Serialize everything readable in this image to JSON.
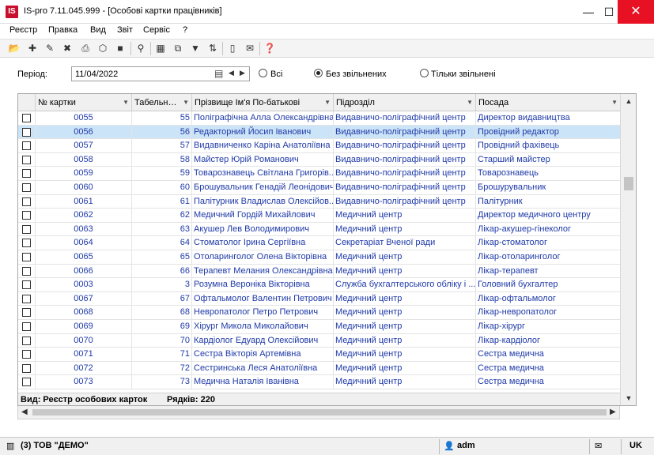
{
  "window": {
    "logo_text": "IS",
    "title": "IS-pro 7.11.045.999 - [Особові картки працівників]",
    "min_glyph": "—",
    "max_glyph": "☐",
    "close_glyph": "✕"
  },
  "menu": [
    "Реєстр",
    "Правка",
    "Вид",
    "Звіт",
    "Сервіс",
    "?"
  ],
  "filter": {
    "period_label": "Період:",
    "period_value": "11/04/2022",
    "radio_all": "Всі",
    "radio_without_dismissed": "Без звільнених",
    "radio_only_dismissed": "Тільки звільнені",
    "selected": "radio_without_dismissed"
  },
  "grid": {
    "columns": {
      "card": "№ картки",
      "tab": "Табельн…",
      "name": "Прізвище Ім'я По-батькові",
      "dept": "Підрозділ",
      "pos": "Посада"
    },
    "selected_row": 1,
    "rows": [
      {
        "card": "0055",
        "tab": "55",
        "name": "Поліграфічна Алла Олександрівна",
        "dept": "Видавничо-поліграфічний центр",
        "pos": "Директор видавництва"
      },
      {
        "card": "0056",
        "tab": "56",
        "name": "Редакторний Йосип Іванович",
        "dept": "Видавничо-поліграфічний центр",
        "pos": "Провідний редактор"
      },
      {
        "card": "0057",
        "tab": "57",
        "name": "Видавниченко Каріна Анатоліївна",
        "dept": "Видавничо-поліграфічний центр",
        "pos": "Провідний фахівець"
      },
      {
        "card": "0058",
        "tab": "58",
        "name": "Майстер Юрій Романович",
        "dept": "Видавничо-поліграфічний центр",
        "pos": "Старший майстер"
      },
      {
        "card": "0059",
        "tab": "59",
        "name": "Товарознавець Світлана Григорів...",
        "dept": "Видавничо-поліграфічний центр",
        "pos": "Товарознавець"
      },
      {
        "card": "0060",
        "tab": "60",
        "name": "Брошувальник Генадій Леонідович",
        "dept": "Видавничо-поліграфічний центр",
        "pos": "Брошурувальник"
      },
      {
        "card": "0061",
        "tab": "61",
        "name": "Палітурник Владислав Олексійов...",
        "dept": "Видавничо-поліграфічний центр",
        "pos": "Палітурник"
      },
      {
        "card": "0062",
        "tab": "62",
        "name": "Медичний Гордій Михайлович",
        "dept": "Медичний центр",
        "pos": "Директор медичного центру"
      },
      {
        "card": "0063",
        "tab": "63",
        "name": "Акушер Лев Володимирович",
        "dept": "Медичний центр",
        "pos": "Лікар-акушер-гінеколог"
      },
      {
        "card": "0064",
        "tab": "64",
        "name": "Стоматолог Ірина Сергіївна",
        "dept": "Секретаріат Вченої ради",
        "pos": "Лікар-стоматолог"
      },
      {
        "card": "0065",
        "tab": "65",
        "name": "Отоларинголог Олена Вікторівна",
        "dept": "Медичний центр",
        "pos": "Лікар-отоларинголог"
      },
      {
        "card": "0066",
        "tab": "66",
        "name": "Терапевт Мелания Олександрівна",
        "dept": "Медичний центр",
        "pos": "Лікар-терапевт"
      },
      {
        "card": "0003",
        "tab": "3",
        "name": "Розумна Вероніка Вікторівна",
        "dept": "Служба бухгалтерського обліку і ...",
        "pos": "Головний бухгалтер"
      },
      {
        "card": "0067",
        "tab": "67",
        "name": "Офтальмолог Валентин Петрович",
        "dept": "Медичний центр",
        "pos": "Лікар-офтальмолог"
      },
      {
        "card": "0068",
        "tab": "68",
        "name": "Невропатолог Петро Петрович",
        "dept": "Медичний центр",
        "pos": "Лікар-невропатолог"
      },
      {
        "card": "0069",
        "tab": "69",
        "name": "Хірург Микола Миколайович",
        "dept": "Медичний центр",
        "pos": "Лікар-хірург"
      },
      {
        "card": "0070",
        "tab": "70",
        "name": "Кардіолог Едуард Олексійович",
        "dept": "Медичний центр",
        "pos": "Лікар-кардіолог"
      },
      {
        "card": "0071",
        "tab": "71",
        "name": "Сестра Вікторія Артемівна",
        "dept": "Медичний центр",
        "pos": "Сестра медична"
      },
      {
        "card": "0072",
        "tab": "72",
        "name": "Сестринська Леся Анатоліївна",
        "dept": "Медичний центр",
        "pos": "Сестра медична"
      },
      {
        "card": "0073",
        "tab": "73",
        "name": "Медична Наталія Іванівна",
        "dept": "Медичний центр",
        "pos": "Сестра медична"
      }
    ],
    "footer_view": "Вид: Реєстр особових карток",
    "footer_rows": "Рядків: 220"
  },
  "status": {
    "company": "(3) ТОВ \"ДЕМО\"",
    "user": "adm",
    "lang": "UK"
  }
}
